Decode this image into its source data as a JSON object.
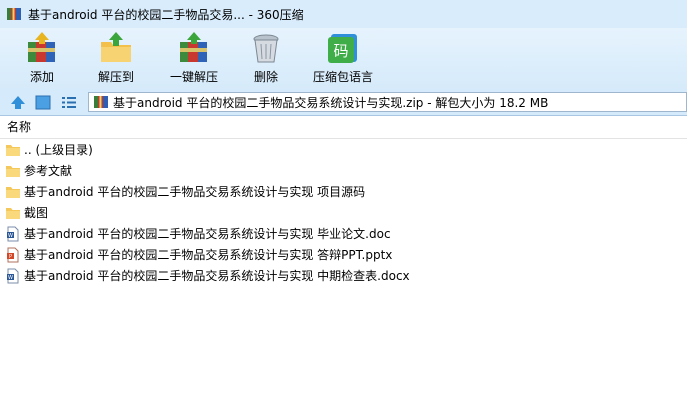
{
  "window": {
    "title": "基于android 平台的校园二手物品交易... - 360压缩"
  },
  "toolbar": {
    "buttons": [
      {
        "id": "add",
        "label": "添加"
      },
      {
        "id": "extract-to",
        "label": "解压到"
      },
      {
        "id": "one-click-extract",
        "label": "一键解压"
      },
      {
        "id": "delete",
        "label": "删除"
      },
      {
        "id": "archive-language",
        "label": "压缩包语言"
      }
    ],
    "language_glyph": "码"
  },
  "address_bar": {
    "text": "基于android 平台的校园二手物品交易系统设计与实现.zip - 解包大小为 18.2 MB"
  },
  "file_list": {
    "column_name": "名称",
    "rows": [
      {
        "name": ".. (上级目录)",
        "icon": "folder-icon"
      },
      {
        "name": "参考文献",
        "icon": "folder-icon"
      },
      {
        "name": "基于android 平台的校园二手物品交易系统设计与实现 项目源码",
        "icon": "folder-icon"
      },
      {
        "name": "截图",
        "icon": "folder-icon"
      },
      {
        "name": "基于android 平台的校园二手物品交易系统设计与实现 毕业论文.doc",
        "icon": "word-doc-icon"
      },
      {
        "name": "基于android 平台的校园二手物品交易系统设计与实现 答辩PPT.pptx",
        "icon": "powerpoint-icon"
      },
      {
        "name": "基于android 平台的校园二手物品交易系统设计与实现 中期检查表.docx",
        "icon": "word-doc-icon"
      }
    ]
  },
  "colors": {
    "titlebar": "#d8ecfb",
    "toolbar": "#d5eafa",
    "folder": "#f5c85b",
    "word": "#2b5797",
    "powerpoint": "#d24726"
  }
}
